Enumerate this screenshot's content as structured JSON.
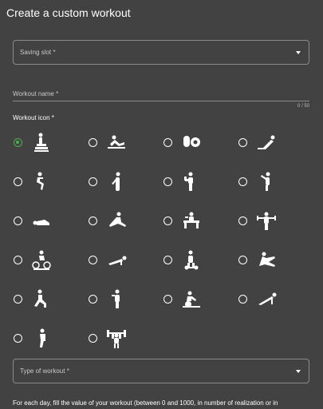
{
  "title": "Create a custom workout",
  "saving_slot": {
    "label": "Saving slot *"
  },
  "workout_name": {
    "label": "Workout name *",
    "counter": "0 / 50"
  },
  "workout_icon": {
    "label": "Workout icon *",
    "selected_index": 0,
    "icons": [
      "stepper-exercise-icon",
      "situp-icon",
      "kettlebell-icon",
      "stretch-icon",
      "squat-icon",
      "standing-stretch-icon",
      "bicep-curl-icon",
      "arm-raise-icon",
      "lying-stretch-icon",
      "leg-stretch-icon",
      "bench-press-icon",
      "dumbbell-lateral-raise-icon",
      "cycling-icon",
      "plank-icon",
      "elliptical-icon",
      "seated-stretch-icon",
      "lunge-icon",
      "standing-icon",
      "rowing-machine-icon",
      "pushup-icon",
      "stretching-person-icon",
      "barbell-lift-icon"
    ]
  },
  "type_of_workout": {
    "label": "Type of workout *"
  },
  "footer_text": "For each day, fill the value of your workout (between 0 and 1000, in number of realization or in",
  "colors": {
    "background": "#424242",
    "accent": "#4caf50",
    "border": "#8a8a8a"
  }
}
